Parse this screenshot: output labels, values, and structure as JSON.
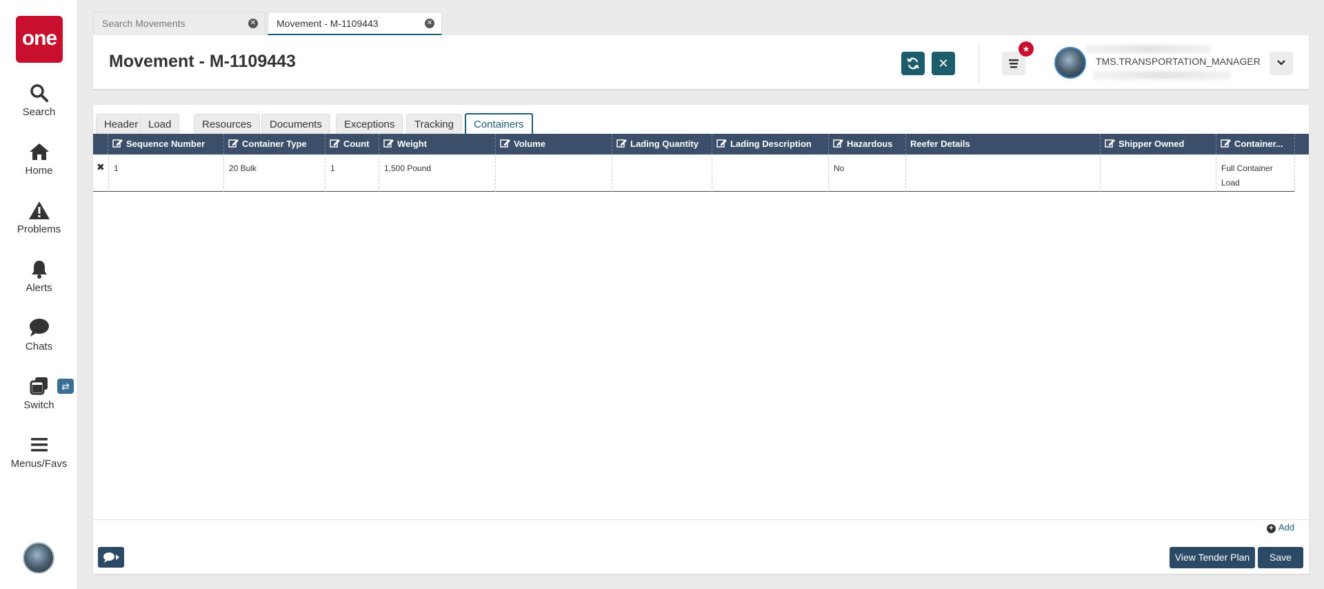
{
  "app": {
    "logo_text": "one",
    "brand_color": "#c8102e",
    "accent_color": "#1c5c6b"
  },
  "nav": {
    "items": [
      {
        "label": "Search",
        "icon": "search-icon"
      },
      {
        "label": "Home",
        "icon": "home-icon"
      },
      {
        "label": "Problems",
        "icon": "warning-icon"
      },
      {
        "label": "Alerts",
        "icon": "bell-icon"
      },
      {
        "label": "Chats",
        "icon": "chat-icon"
      },
      {
        "label": "Switch",
        "icon": "switch-icon"
      },
      {
        "label": "Menus/Favs",
        "icon": "menu-icon"
      }
    ]
  },
  "top_tabs": [
    {
      "label": "Search Movements",
      "active": false
    },
    {
      "label": "Movement - M-1109443",
      "active": true
    }
  ],
  "header": {
    "title": "Movement - M-1109443",
    "user_name": "TMS.TRANSPORTATION_MANAGER"
  },
  "subtabs": [
    "Header",
    "Load",
    "Resources",
    "Documents",
    "Exceptions",
    "Tracking",
    "Containers"
  ],
  "active_subtab": "Containers",
  "grid": {
    "columns": [
      {
        "label": "Sequence Number",
        "editable": true
      },
      {
        "label": "Container Type",
        "editable": true
      },
      {
        "label": "Count",
        "editable": true
      },
      {
        "label": "Weight",
        "editable": true
      },
      {
        "label": "Volume",
        "editable": true
      },
      {
        "label": "Lading Quantity",
        "editable": true
      },
      {
        "label": "Lading Description",
        "editable": true
      },
      {
        "label": "Hazardous",
        "editable": true
      },
      {
        "label": "Reefer Details",
        "editable": false
      },
      {
        "label": "Shipper Owned",
        "editable": true
      },
      {
        "label": "Container...",
        "editable": true
      }
    ],
    "rows": [
      [
        "1",
        "20 Bulk",
        "1",
        "1,500 Pound",
        "",
        "",
        "",
        "No",
        "",
        "",
        "Full Container Load"
      ]
    ]
  },
  "footer": {
    "add_label": "Add",
    "view_tender_plan_label": "View Tender Plan",
    "save_label": "Save"
  }
}
